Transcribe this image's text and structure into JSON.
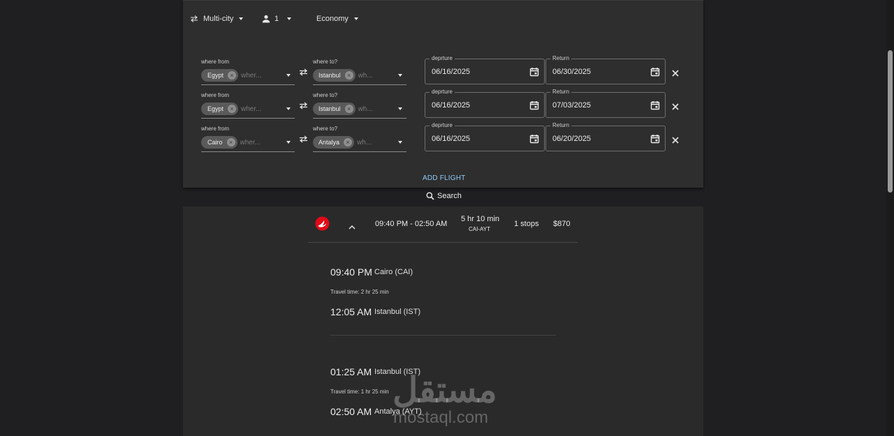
{
  "search": {
    "trip_type": "Multi-city",
    "passengers": "1",
    "cabin_class": "Economy",
    "add_flight": "ADD FLIGHT",
    "search_label": "Search",
    "legs": [
      {
        "from_label": "where from",
        "from": "Egypt",
        "from_placeholder": "wher...",
        "to_label": "where to?",
        "to": "Istanbul",
        "to_placeholder": "wh...",
        "departure_label": "deprture",
        "departure": "06/16/2025",
        "return_label": "Return",
        "return": "06/30/2025"
      },
      {
        "from_label": "where from",
        "from": "Egypt",
        "from_placeholder": "wher...",
        "to_label": "where to?",
        "to": "Istanbul",
        "to_placeholder": "wh...",
        "departure_label": "deprture",
        "departure": "06/16/2025",
        "return_label": "Return",
        "return": "07/03/2025"
      },
      {
        "from_label": "where from",
        "from": "Cairo",
        "from_placeholder": "wher...",
        "to_label": "where to?",
        "to": "Antalya",
        "to_placeholder": "wh...",
        "departure_label": "deprture",
        "departure": "06/16/2025",
        "return_label": "Return",
        "return": "06/20/2025"
      }
    ]
  },
  "result": {
    "airline_icon": "turkish-airlines-logo",
    "times": "09:40 PM - 02:50 AM",
    "duration": "5 hr 10 min",
    "route": "CAI-AYT",
    "stops": "1 stops",
    "price": "$870",
    "segments": [
      {
        "dep_time": "09:40 PM",
        "dep_place": "Cairo (CAI)",
        "travel_time": "Travel time: 2 hr 25 min",
        "arr_time": "12:05 AM",
        "arr_place": "Istanbul (IST)"
      },
      {
        "dep_time": "01:25 AM",
        "dep_place": "Istanbul (IST)",
        "travel_time": "Travel time: 1 hr 25 min",
        "arr_time": "02:50 AM",
        "arr_place": "Antalya (AYT)"
      }
    ]
  },
  "watermark": {
    "arabic": "مستقل",
    "latin": "mostaql.com"
  },
  "colors": {
    "accent": "#90caf9",
    "airline_red": "#e30a17",
    "panel_bg": "#2e2e2e",
    "page_bg": "#1f1f21"
  }
}
